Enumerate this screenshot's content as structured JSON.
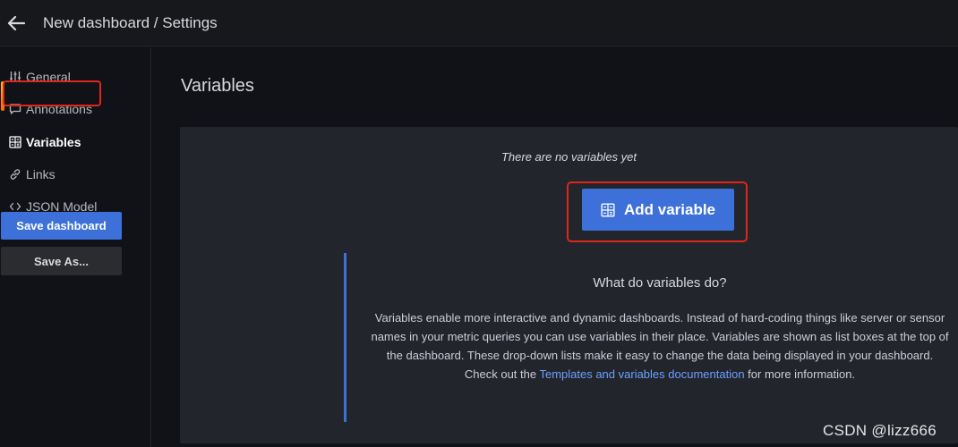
{
  "header": {
    "title": "New dashboard / Settings",
    "back_icon": "arrow-left-icon"
  },
  "sidebar": {
    "items": [
      {
        "label": "General",
        "icon": "sliders-icon"
      },
      {
        "label": "Annotations",
        "icon": "comment-icon"
      },
      {
        "label": "Variables",
        "icon": "calculator-icon",
        "active": true
      },
      {
        "label": "Links",
        "icon": "link-icon"
      },
      {
        "label": "JSON Model",
        "icon": "code-icon"
      }
    ],
    "save_label": "Save dashboard",
    "save_as_label": "Save As..."
  },
  "main": {
    "title": "Variables",
    "empty_message": "There are no variables yet",
    "add_button_label": "Add variable",
    "info": {
      "heading": "What do variables do?",
      "body_before": "Variables enable more interactive and dynamic dashboards. Instead of hard-coding things like server or sensor names in your metric queries you can use variables in their place. Variables are shown as list boxes at the top of the dashboard. These drop-down lists make it easy to change the data being displayed in your dashboard. Check out the ",
      "link_text": "Templates and variables documentation",
      "body_after": " for more information."
    }
  },
  "watermark": "CSDN @lizz666",
  "colors": {
    "accent": "#3d71d9",
    "highlight": "#e0251c",
    "link": "#6e9fff"
  }
}
